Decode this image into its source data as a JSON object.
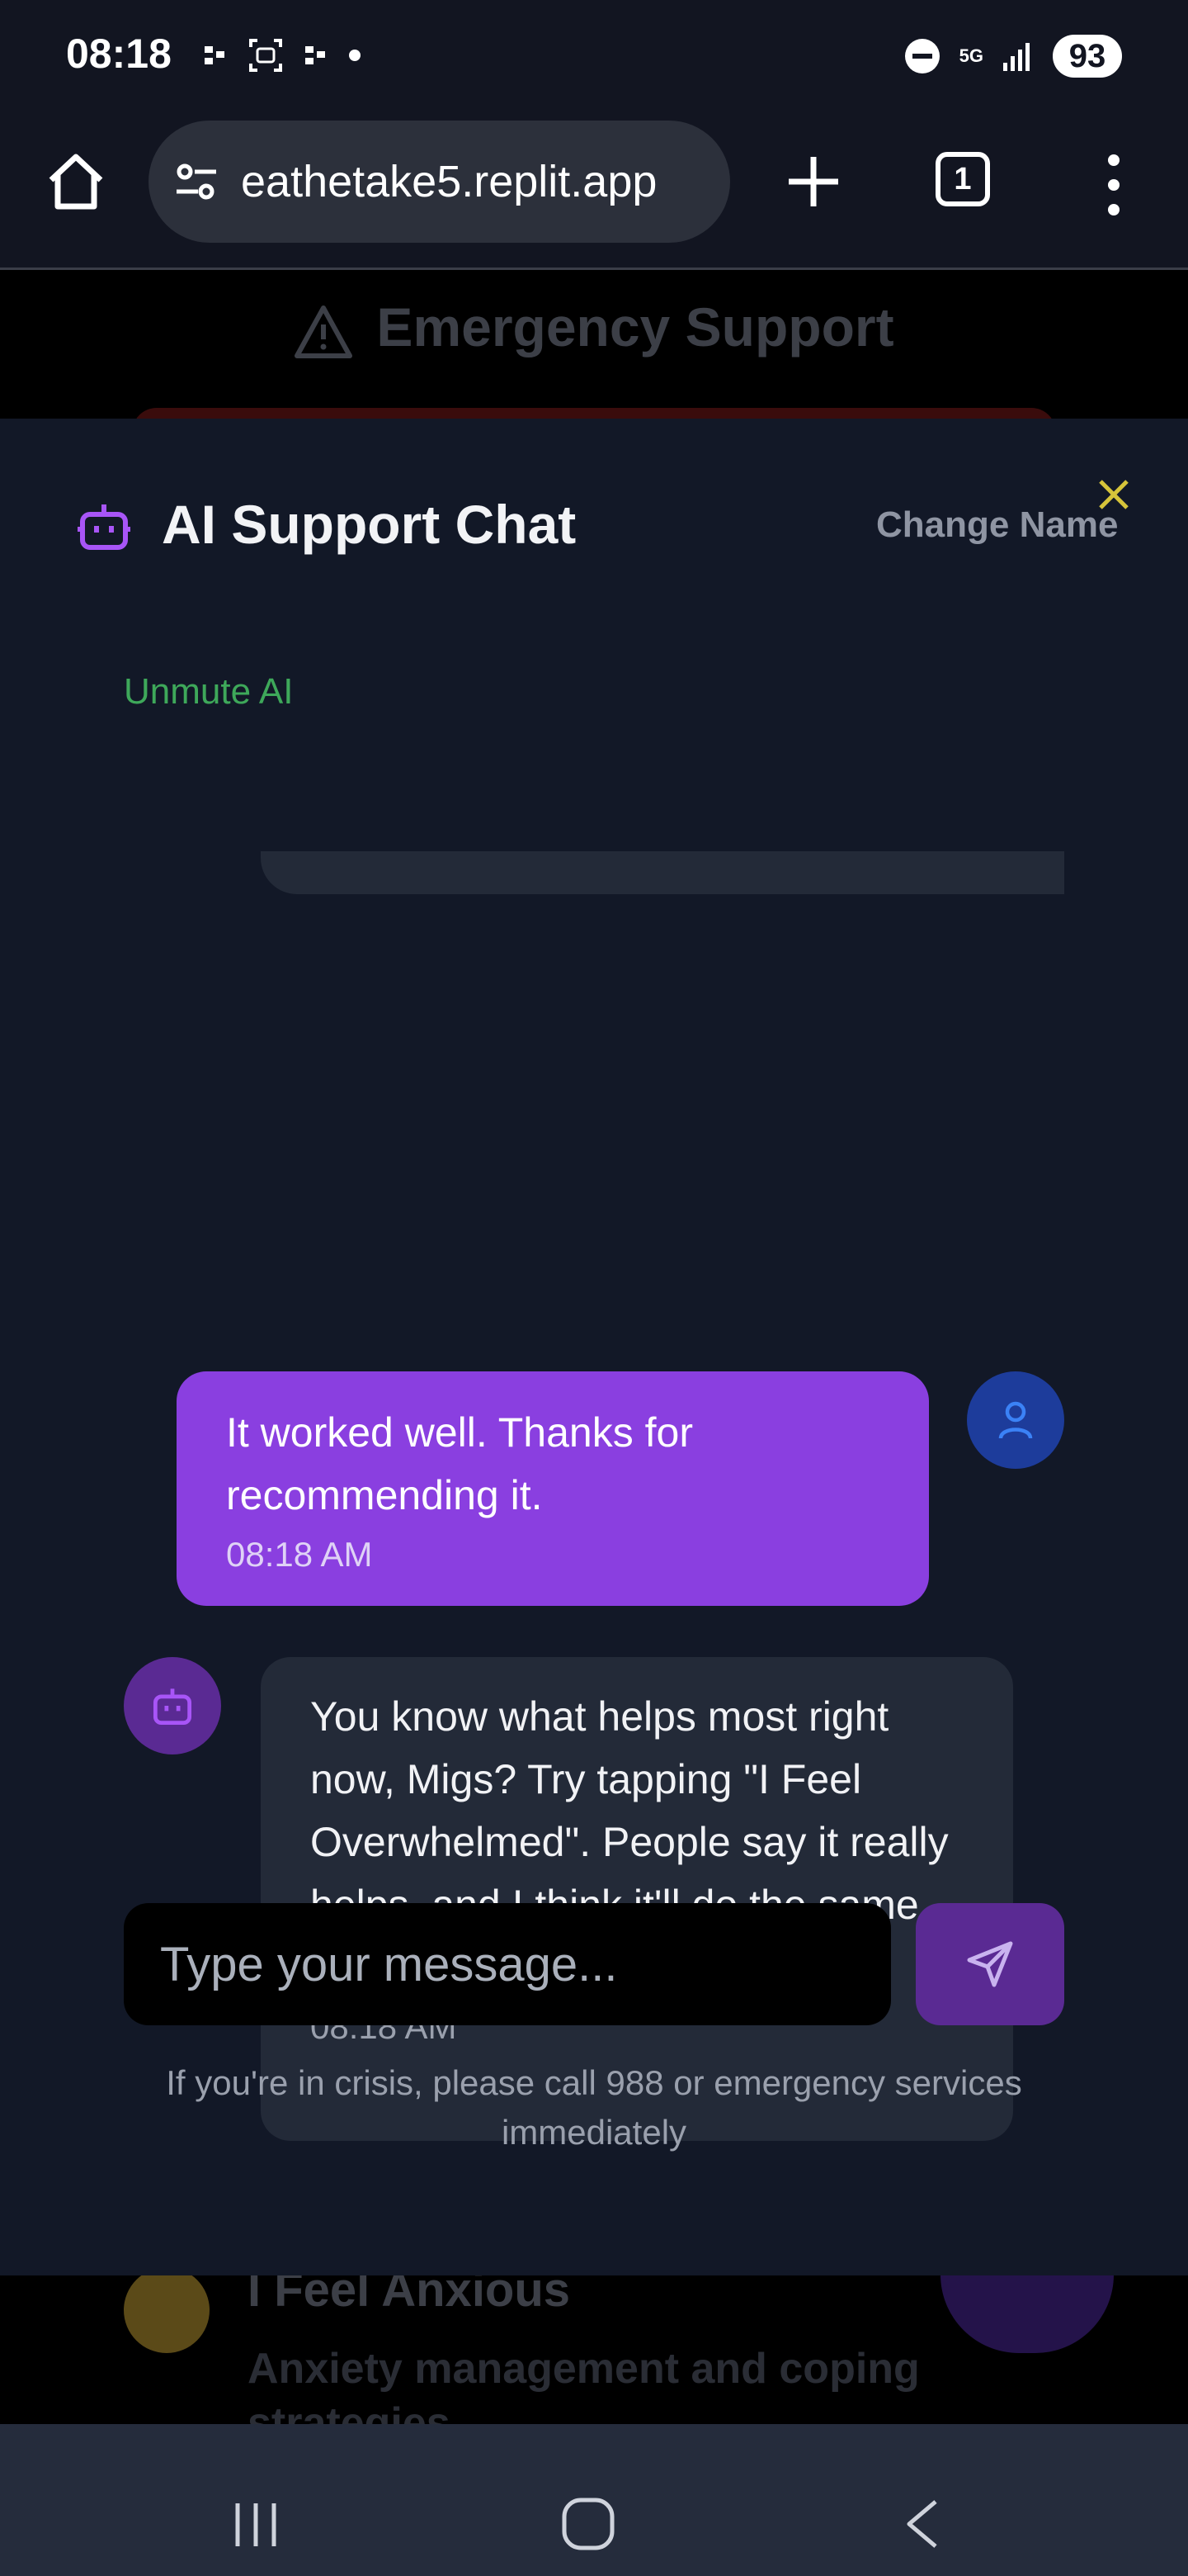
{
  "status_bar": {
    "time": "08:18",
    "battery": "93",
    "network": "5G"
  },
  "browser": {
    "url": "eathetake5.replit.app",
    "tab_count": "1"
  },
  "background_page": {
    "emergency_title": "Emergency Support",
    "card_title": "I Feel Anxious",
    "card_subtitle": "Anxiety management and coping strategies"
  },
  "chat": {
    "title": "AI Support Chat",
    "change_name": "Change Name",
    "unmute": "Unmute AI",
    "messages": [
      {
        "role": "user",
        "text": "It worked well. Thanks for recommending it.",
        "time": "08:18 AM"
      },
      {
        "role": "assistant",
        "text": "You know what helps most right now, Migs? Try tapping \"I Feel Overwhelmed\". People say it really helps, and I think it'll do the same for you. I'll be right here after.",
        "time": "08:18 AM"
      }
    ],
    "input_placeholder": "Type your message...",
    "crisis_notice": "If you're in crisis, please call 988 or emergency services immediately"
  },
  "colors": {
    "accent_purple": "#8a3fe0",
    "modal_bg": "#121827",
    "unmute_green": "#3ea85a",
    "close_yellow": "#d6c43a"
  }
}
